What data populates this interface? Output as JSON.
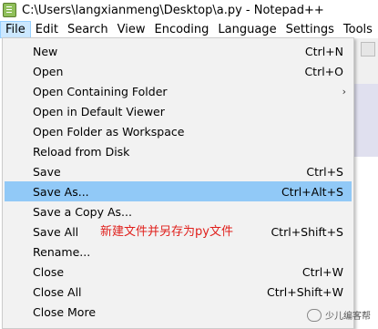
{
  "window": {
    "title": "C:\\Users\\langxianmeng\\Desktop\\a.py - Notepad++",
    "app_icon": "notepad-plus-plus-icon"
  },
  "menubar": {
    "items": [
      "File",
      "Edit",
      "Search",
      "View",
      "Encoding",
      "Language",
      "Settings",
      "Tools"
    ],
    "active": "File"
  },
  "file_menu": {
    "items": [
      {
        "label": "New",
        "shortcut": "Ctrl+N"
      },
      {
        "label": "Open",
        "shortcut": "Ctrl+O"
      },
      {
        "label": "Open Containing Folder",
        "shortcut": "",
        "submenu": true
      },
      {
        "label": "Open in Default Viewer",
        "shortcut": ""
      },
      {
        "label": "Open Folder as Workspace",
        "shortcut": ""
      },
      {
        "label": "Reload from Disk",
        "shortcut": ""
      },
      {
        "label": "Save",
        "shortcut": "Ctrl+S"
      },
      {
        "label": "Save As...",
        "shortcut": "Ctrl+Alt+S",
        "highlighted": true
      },
      {
        "label": "Save a Copy As...",
        "shortcut": ""
      },
      {
        "label": "Save All",
        "shortcut": "Ctrl+Shift+S"
      },
      {
        "label": "Rename...",
        "shortcut": ""
      },
      {
        "label": "Close",
        "shortcut": "Ctrl+W"
      },
      {
        "label": "Close All",
        "shortcut": "Ctrl+Shift+W"
      },
      {
        "label": "Close More",
        "shortcut": ""
      }
    ],
    "highlight_color": "#91c9f7",
    "menu_bg": "#f2f2f2"
  },
  "annotation": {
    "text": "新建文件并另存为py文件",
    "color": "#e0201c"
  },
  "watermark": {
    "text": "少儿编客帮"
  }
}
